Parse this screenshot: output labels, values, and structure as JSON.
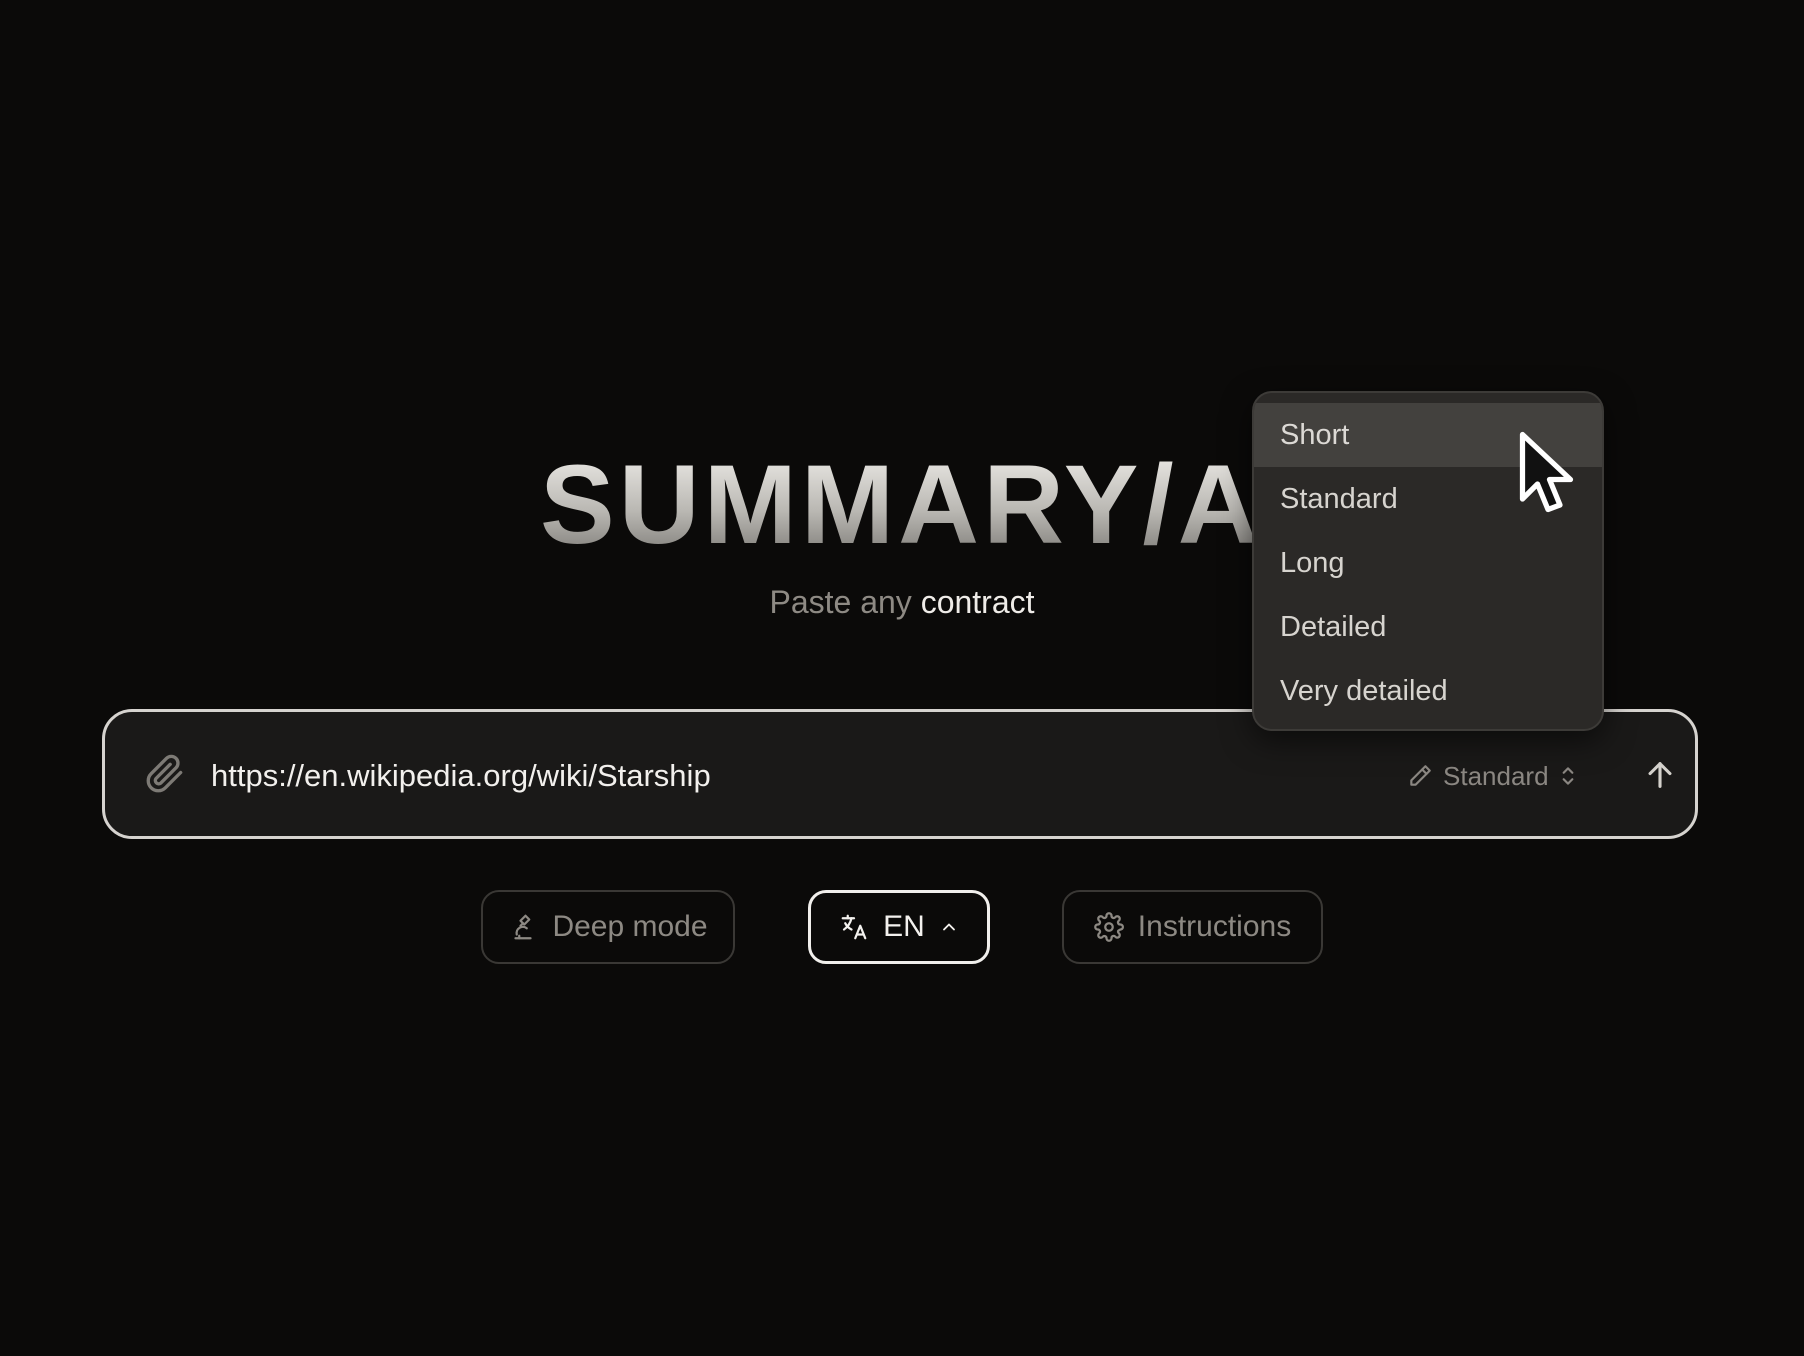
{
  "hero": {
    "logo": "SUMMARY/AI",
    "tagline_prefix": "Paste any ",
    "tagline_accent": "contract"
  },
  "input": {
    "value": "https://en.wikipedia.org/wiki/Starship",
    "attach_icon": "paperclip-icon",
    "length_label": "Standard",
    "length_icon": "ruler-pencil-icon",
    "submit_icon": "arrow-up-icon"
  },
  "buttons": {
    "deep_mode": "Deep mode",
    "language": "EN",
    "instructions": "Instructions"
  },
  "dropdown": {
    "items": [
      "Short",
      "Standard",
      "Long",
      "Detailed",
      "Very detailed"
    ],
    "highlighted": "Short"
  },
  "colors": {
    "background": "#0b0a09",
    "input_border": "#d6d3cf",
    "dropdown_bg": "#2b2927",
    "dropdown_active": "#43413e"
  }
}
